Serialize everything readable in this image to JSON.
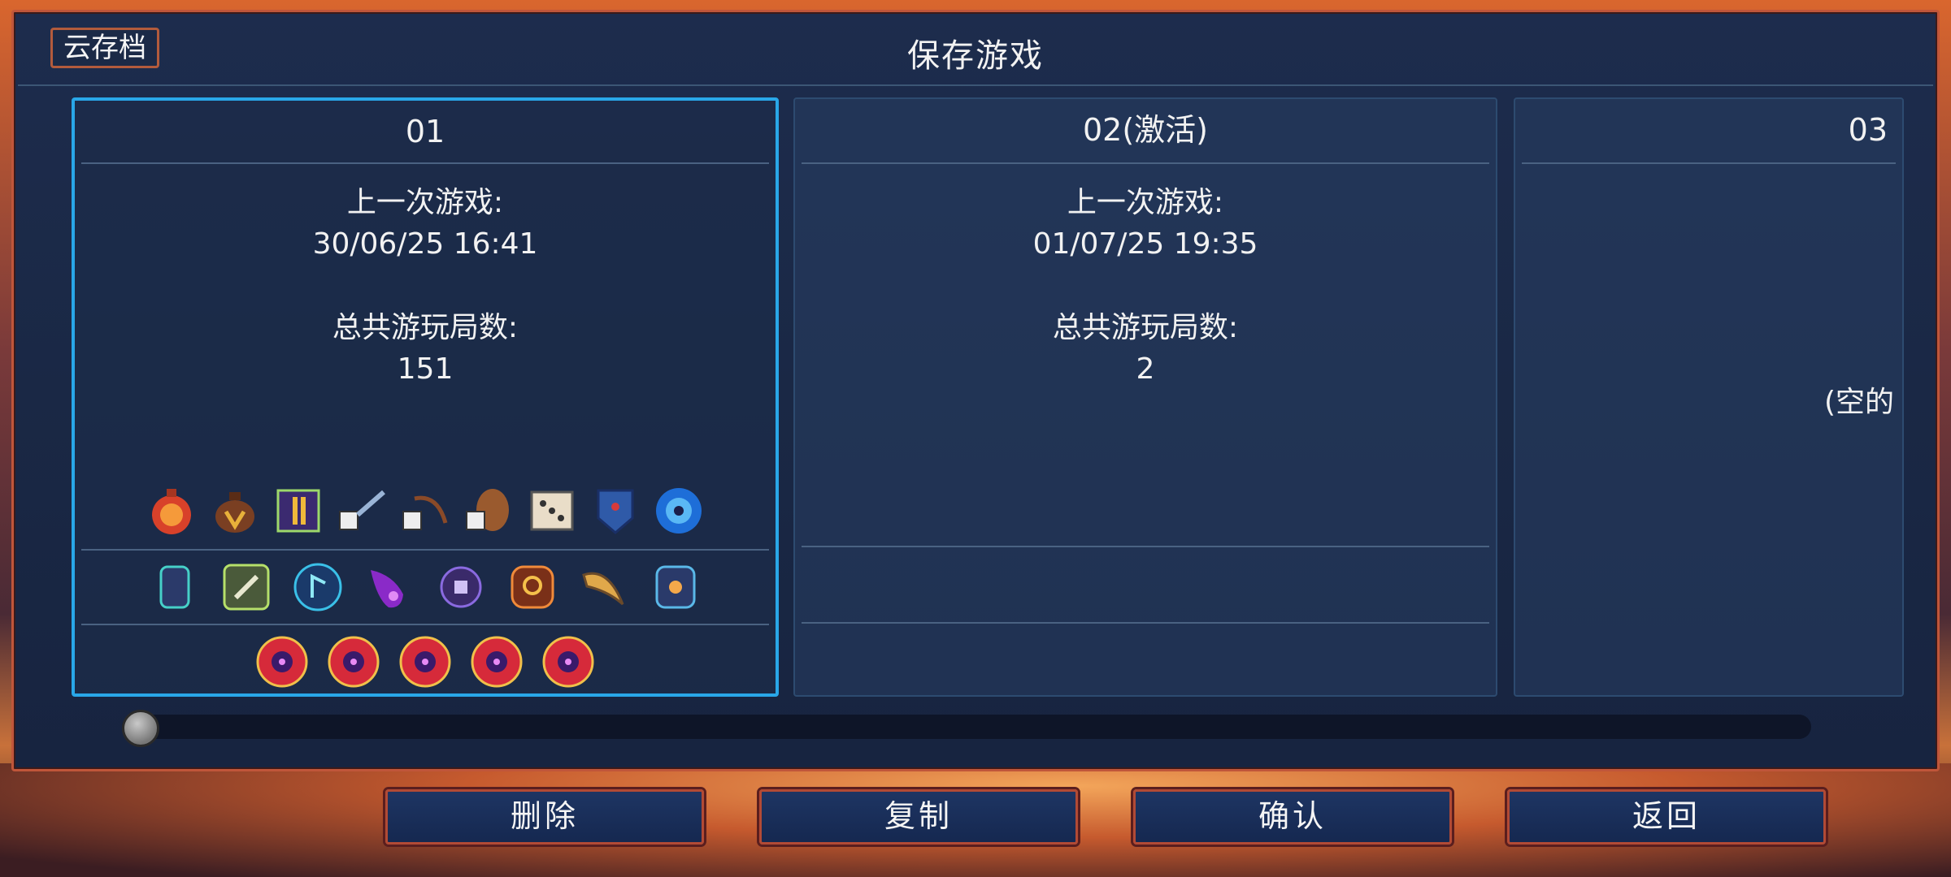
{
  "header": {
    "cloud_save_label": "云存档",
    "title": "保存游戏"
  },
  "slots": [
    {
      "name": "01",
      "last_played_label": "上一次游戏:",
      "last_played_value": "30/06/25 16:41",
      "total_runs_label": "总共游玩局数:",
      "total_runs_value": "151",
      "selected": true,
      "item_icons": [
        "fire-potion-icon",
        "loot-bag-icon",
        "rune-scroll-icon",
        "dice-blade-icon",
        "dice-bow-icon",
        "dice-shield-icon",
        "dice-icon",
        "blue-shield-icon",
        "blue-orb-icon"
      ],
      "rune_icons": [
        "vine-rune-icon",
        "bone-rune-icon",
        "teleport-rune-icon",
        "purple-flame-icon",
        "mech-eye-icon",
        "amber-rune-icon",
        "horn-icon",
        "spider-rune-icon"
      ],
      "cell_icons": [
        "boss-cell-icon",
        "boss-cell-icon",
        "boss-cell-icon",
        "boss-cell-icon",
        "boss-cell-icon"
      ]
    },
    {
      "name": "02(激活)",
      "last_played_label": "上一次游戏:",
      "last_played_value": "01/07/25 19:35",
      "total_runs_label": "总共游玩局数:",
      "total_runs_value": "2",
      "selected": false
    },
    {
      "name": "03",
      "empty_label": "(空的",
      "selected": false
    }
  ],
  "buttons": {
    "delete": "删除",
    "copy": "复制",
    "confirm": "确认",
    "back": "返回"
  },
  "colors": {
    "selected_border": "#29a7e8",
    "panel_border": "#c0563a",
    "panel_bg": "#1d2c4d"
  }
}
